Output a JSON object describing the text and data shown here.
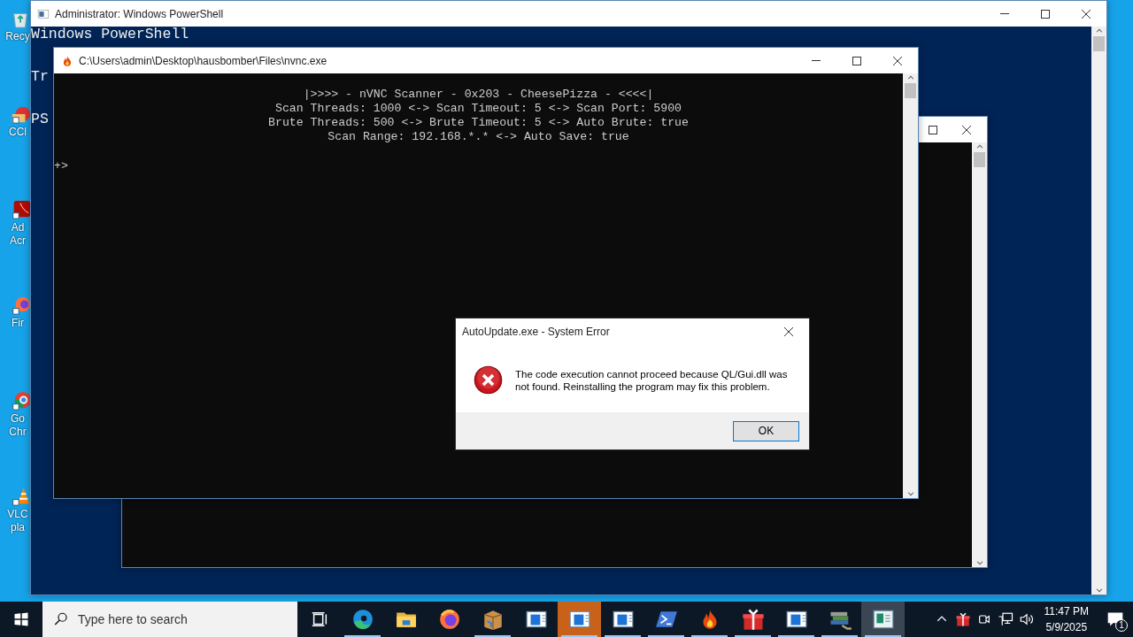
{
  "desktop_icons": [
    {
      "kind": "recycle-bin",
      "label_lines": [
        "Recy"
      ]
    },
    {
      "kind": "ccleaner",
      "label_lines": [
        "CCl"
      ]
    },
    {
      "kind": "acrobat",
      "label_lines": [
        "Ad",
        "Acr"
      ]
    },
    {
      "kind": "firefox",
      "label_lines": [
        "Fir"
      ]
    },
    {
      "kind": "chrome",
      "label_lines": [
        "Go",
        "Chr"
      ]
    },
    {
      "kind": "vlc",
      "label_lines": [
        "VLC",
        "pla"
      ]
    }
  ],
  "windows": [
    {
      "kind": "powershell",
      "title": "Administrator: Windows PowerShell",
      "paragraphs": [
        [
          "Windows PowerShell"
        ],
        [
          "Tr"
        ],
        [
          "PS"
        ]
      ]
    },
    {
      "kind": "hidden-console"
    },
    {
      "kind": "scanner",
      "title": "C:\\Users\\admin\\Desktop\\hausbomber\\Files\\nvnc.exe",
      "header_lines": [
        "|>>>> - nVNC Scanner - 0x203 - CheesePizza - <<<<|",
        "Scan Threads: 1000 <-> Scan Timeout: 5 <-> Scan Port: 5900",
        "Brute Threads: 500 <-> Brute Timeout: 5 <-> Auto Brute: true",
        "Scan Range: 192.168.*.* <-> Auto Save: true"
      ],
      "prompt": "+>"
    }
  ],
  "dialog": {
    "title": "AutoUpdate.exe - System Error",
    "message": "The code execution cannot proceed because QL/Gui.dll was not found. Reinstalling the program may fix this problem.",
    "button": "OK"
  },
  "taskbar": {
    "search": {
      "placeholder": "Type here to search"
    },
    "apps": [
      {
        "kind": "taskview",
        "running": false,
        "attention": false,
        "focused": false
      },
      {
        "kind": "edge",
        "running": true,
        "attention": false,
        "focused": false
      },
      {
        "kind": "folder",
        "running": false,
        "attention": false,
        "focused": false
      },
      {
        "kind": "firefox",
        "running": false,
        "attention": false,
        "focused": false
      },
      {
        "kind": "package",
        "running": true,
        "attention": false,
        "focused": false
      },
      {
        "kind": "app-window",
        "running": false,
        "attention": false,
        "focused": false
      },
      {
        "kind": "app-window",
        "running": true,
        "attention": true,
        "focused": false
      },
      {
        "kind": "app-window",
        "running": true,
        "attention": false,
        "focused": false
      },
      {
        "kind": "powershell",
        "running": true,
        "attention": false,
        "focused": false
      },
      {
        "kind": "flame",
        "running": true,
        "attention": false,
        "focused": false
      },
      {
        "kind": "gift",
        "running": true,
        "attention": false,
        "focused": false
      },
      {
        "kind": "app-window",
        "running": true,
        "attention": false,
        "focused": false
      },
      {
        "kind": "books",
        "running": true,
        "attention": false,
        "focused": false
      },
      {
        "kind": "console-window",
        "running": true,
        "attention": false,
        "focused": true
      }
    ],
    "tray": [
      {
        "kind": "chevron"
      },
      {
        "kind": "gift"
      },
      {
        "kind": "camera"
      },
      {
        "kind": "network"
      },
      {
        "kind": "volume"
      }
    ],
    "time": "11:47 PM",
    "date": "5/9/2025",
    "notifications": "1"
  }
}
